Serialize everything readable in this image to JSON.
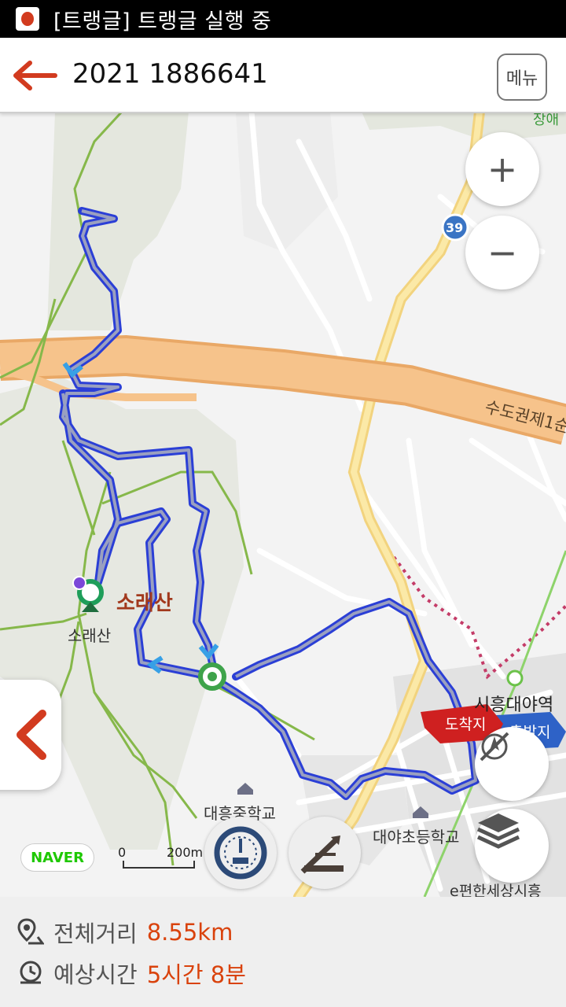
{
  "status_bar": {
    "text": "[트랭글] 트랭글 실행 중"
  },
  "header": {
    "title": "2021 1886641",
    "menu_label": "메뉴"
  },
  "map": {
    "mountain_label_red": "소래산",
    "mountain_label": "소래산",
    "route_sign": "39",
    "highway_label": "수도권제1순",
    "station_label": "시흥대야역",
    "arrival_label": "도착지",
    "departure_label": "출발지",
    "school1": "대흥중학교",
    "school2": "대야초등학교",
    "corner_label": "e편한세상시흥",
    "edge_label": "장애",
    "naver_label": "NAVER",
    "scale_start": "0",
    "scale_end": "200m"
  },
  "info": {
    "distance_label": "전체거리",
    "distance_value": "8.55km",
    "time_label": "예상시간",
    "time_value": "5시간 8분"
  },
  "colors": {
    "accent": "#d9420c",
    "route": "#2b3fd6",
    "route_inner": "#9aa0c0"
  },
  "icons": [
    "back-arrow-icon",
    "zoom-in-icon",
    "zoom-out-icon",
    "compass-off-icon",
    "layers-icon",
    "speed-gauge-icon",
    "elevation-icon",
    "location-pin-icon",
    "clock-icon",
    "chevron-left-icon"
  ]
}
